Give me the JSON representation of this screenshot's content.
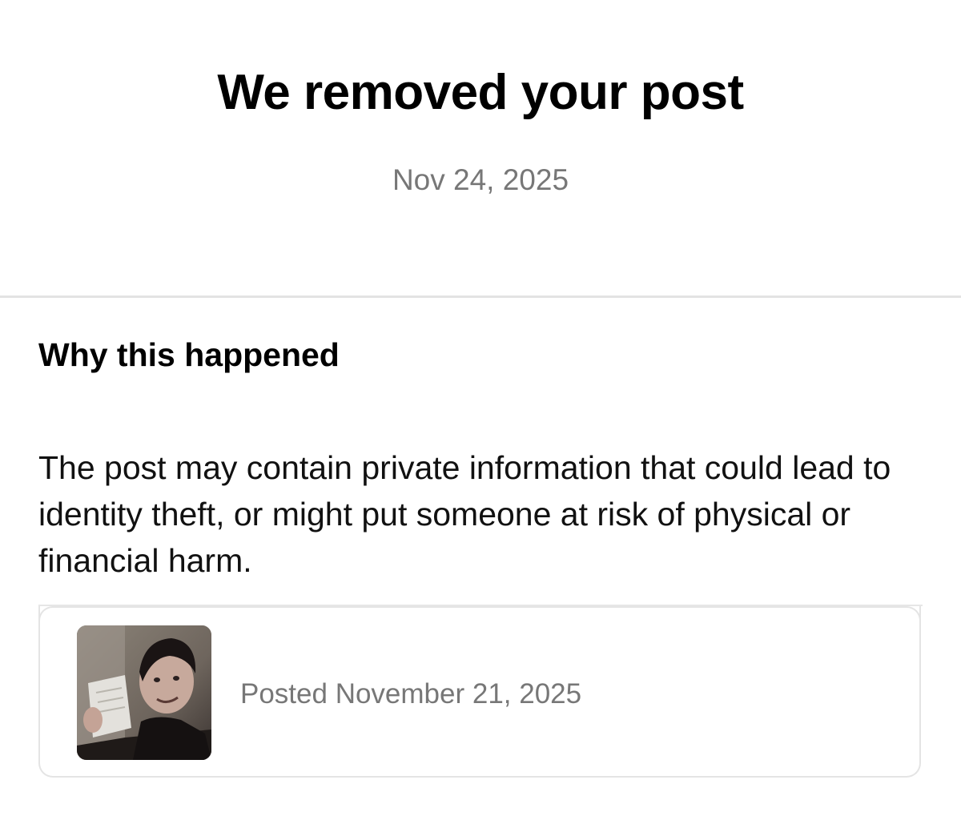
{
  "header": {
    "title": "We removed your post",
    "date": "Nov 24, 2025"
  },
  "reason_section": {
    "heading": "Why this happened",
    "body": "The post may contain private information that could lead to identity theft, or might put someone at risk of physical or financial harm."
  },
  "post": {
    "posted_label": "Posted November 21, 2025",
    "thumbnail_icon": "post-photo-thumbnail"
  },
  "colors": {
    "text_primary": "#000000",
    "text_secondary": "#777777",
    "divider": "#e3e3e3"
  }
}
